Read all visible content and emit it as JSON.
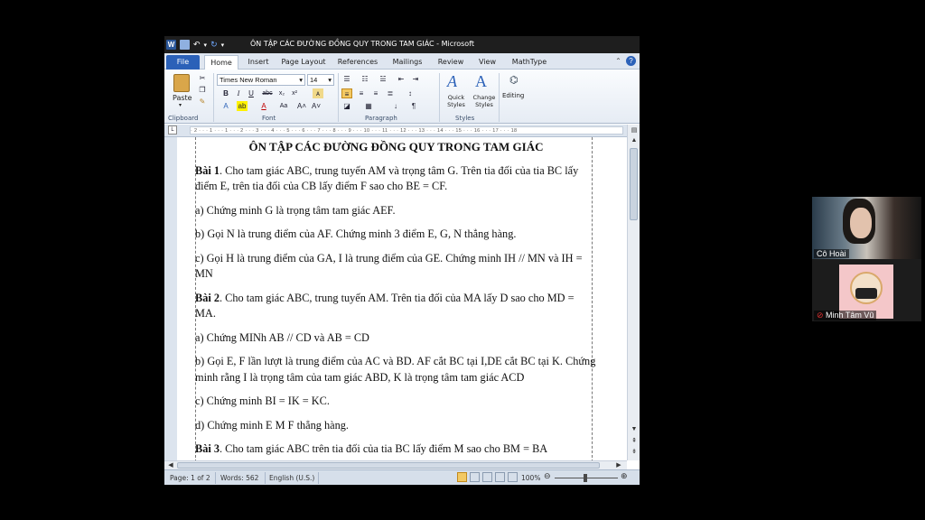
{
  "window": {
    "title": "ÔN TẬP CÁC ĐƯỜNG ĐỒNG QUY TRONG TAM GIÁC  -  Microsoft"
  },
  "ribbon": {
    "tabs": [
      "File",
      "Home",
      "Insert",
      "Page Layout",
      "References",
      "Mailings",
      "Review",
      "View",
      "MathType"
    ],
    "font_name": "Times New Roman",
    "font_size": "14",
    "groups": {
      "clipboard": "Clipboard",
      "font": "Font",
      "paragraph": "Paragraph",
      "styles": "Styles"
    },
    "paste_label": "Paste",
    "quick_styles_label": "Quick Styles",
    "change_styles_label": "Change Styles",
    "editing_label": "Editing"
  },
  "ruler": {
    "text": "· 2 · · · 1 · · · 1 · · · 2 · · · 3 · · · 4 · · · 5 · · · 6 · · · 7 · · · 8 · · · 9 · · · 10 · · · 11 · · · 12 · · · 13 · · · 14 · · · 15 · · · 16 · · · 17 · · · 18"
  },
  "document": {
    "title": "ÔN TẬP CÁC ĐƯỜNG ĐỒNG QUY TRONG TAM GIÁC",
    "p1_label": "Bài 1",
    "p1_text": ".  Cho tam giác ABC, trung tuyến AM và trọng tâm G. Trên tia đối của tia BC lấy điểm E, trên tia đối của CB lấy điểm F sao cho BE = CF.",
    "p2": "a) Chứng minh G là trọng tâm tam giác AEF.",
    "p3": "b) Gọi N là trung điểm của AF. Chứng minh 3 điểm E, G, N thẳng hàng.",
    "p4": "c) Gọi H là trung điểm của GA, I là trung điểm của GE. Chứng minh IH // MN và IH = MN",
    "p5_label": "Bài 2",
    "p5_text": ". Cho tam giác ABC, trung tuyến AM. Trên tia đối của MA lấy D sao cho MD = MA.",
    "p6": "a) Chứng MINh AB // CD và AB = CD",
    "p7": "b) Gọi E, F lần lượt là trung điểm của AC và BD. AF cắt BC tại I,DE cắt BC tại K. Chứng minh rằng I là trọng tâm của tam giác ABD, K là trọng tâm tam giác ACD",
    "p8": "c) Chứng minh BI = IK = KC.",
    "p9": "d) Chứng minh E M F thẳng hàng.",
    "p10_label": "Bài 3",
    "p10_text": ". Cho tam giác ABC trên tia đối của tia BC lấy điểm M sao cho BM = BA"
  },
  "status": {
    "page": "Page: 1 of 2",
    "words": "Words: 562",
    "language": "English (U.S.)",
    "zoom": "100%",
    "zoom_level": 1.0
  },
  "participants": [
    {
      "name": "Cô Hoài"
    },
    {
      "name": "Minh Tâm Vũ",
      "muted": true
    }
  ],
  "colors": {
    "file_tab": "#2b61b8",
    "titlebar": "#1e1e1e",
    "mic_muted": "#e03030"
  }
}
